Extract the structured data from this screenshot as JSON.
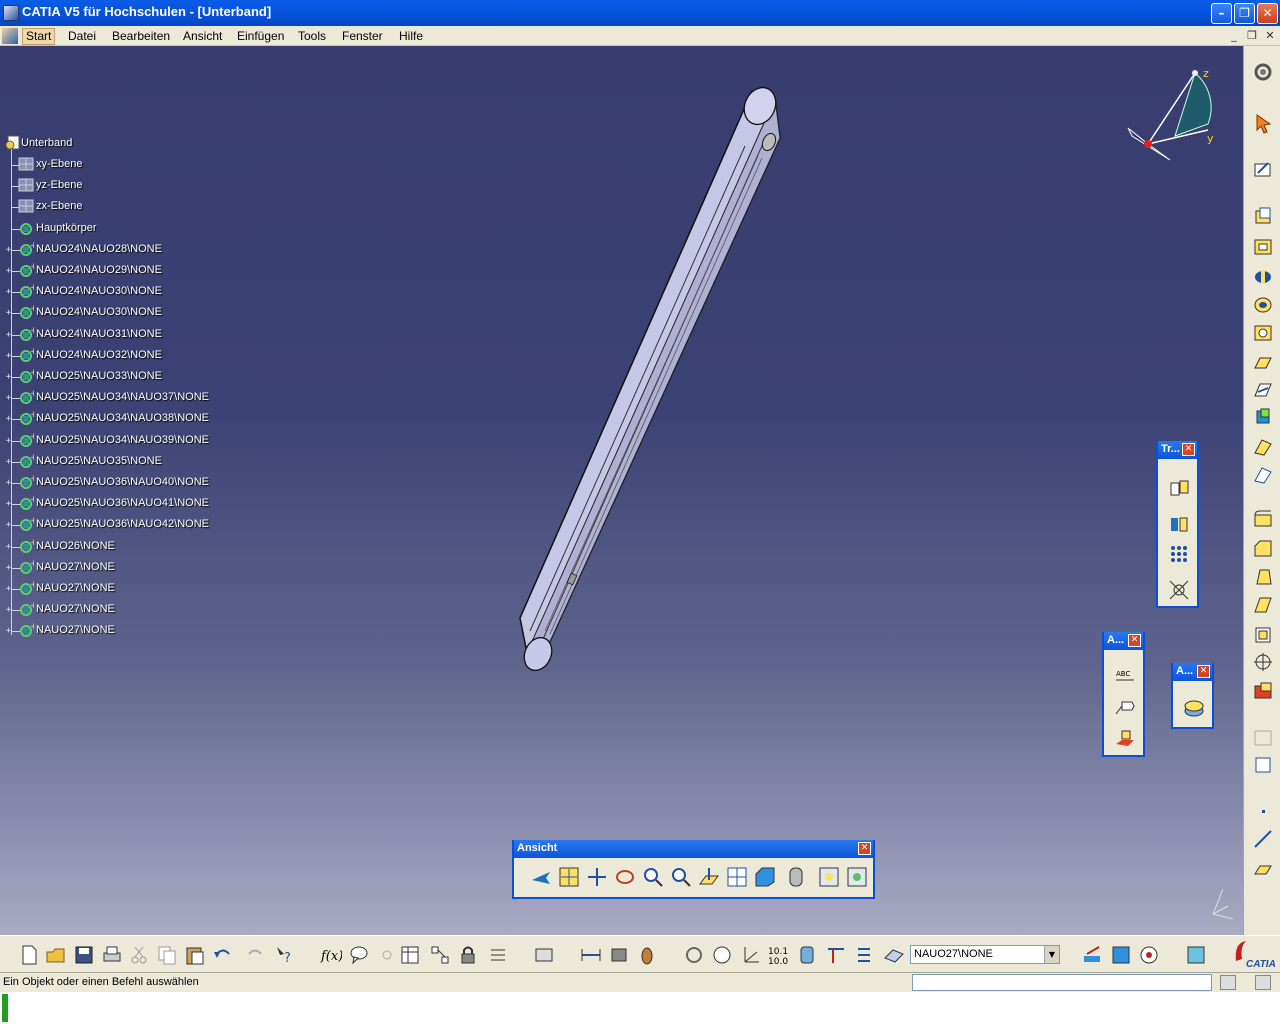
{
  "window": {
    "title": "CATIA V5 für Hochschulen - [Unterband]",
    "controls": [
      "minimize",
      "restore",
      "close"
    ]
  },
  "menu": {
    "items": [
      "Start",
      "Datei",
      "Bearbeiten",
      "Ansicht",
      "Einfügen",
      "Tools",
      "Fenster",
      "Hilfe"
    ],
    "active": "Start"
  },
  "tree": {
    "root": "Unterband",
    "items": [
      {
        "label": "xy-Ebene",
        "icon": "plane-icon",
        "expandable": false
      },
      {
        "label": "yz-Ebene",
        "icon": "plane-icon",
        "expandable": false
      },
      {
        "label": "zx-Ebene",
        "icon": "plane-icon",
        "expandable": false
      },
      {
        "label": "Hauptkörper",
        "icon": "body-icon",
        "expandable": false
      },
      {
        "label": "NAUO24\\NAUO28\\NONE",
        "icon": "body-icon",
        "expandable": true
      },
      {
        "label": "NAUO24\\NAUO29\\NONE",
        "icon": "body-icon",
        "expandable": true
      },
      {
        "label": "NAUO24\\NAUO30\\NONE",
        "icon": "body-icon",
        "expandable": true
      },
      {
        "label": "NAUO24\\NAUO30\\NONE",
        "icon": "body-icon",
        "expandable": true
      },
      {
        "label": "NAUO24\\NAUO31\\NONE",
        "icon": "body-icon",
        "expandable": true
      },
      {
        "label": "NAUO24\\NAUO32\\NONE",
        "icon": "body-icon",
        "expandable": true
      },
      {
        "label": "NAUO25\\NAUO33\\NONE",
        "icon": "body-icon",
        "expandable": true
      },
      {
        "label": "NAUO25\\NAUO34\\NAUO37\\NONE",
        "icon": "body-icon",
        "expandable": true
      },
      {
        "label": "NAUO25\\NAUO34\\NAUO38\\NONE",
        "icon": "body-icon",
        "expandable": true
      },
      {
        "label": "NAUO25\\NAUO34\\NAUO39\\NONE",
        "icon": "body-icon",
        "expandable": true
      },
      {
        "label": "NAUO25\\NAUO35\\NONE",
        "icon": "body-icon",
        "expandable": true
      },
      {
        "label": "NAUO25\\NAUO36\\NAUO40\\NONE",
        "icon": "body-icon",
        "expandable": true
      },
      {
        "label": "NAUO25\\NAUO36\\NAUO41\\NONE",
        "icon": "body-icon",
        "expandable": true
      },
      {
        "label": "NAUO25\\NAUO36\\NAUO42\\NONE",
        "icon": "body-icon",
        "expandable": true
      },
      {
        "label": "NAUO26\\NONE",
        "icon": "body-icon",
        "expandable": true
      },
      {
        "label": "NAUO27\\NONE",
        "icon": "body-icon",
        "expandable": true
      },
      {
        "label": "NAUO27\\NONE",
        "icon": "body-icon",
        "expandable": true
      },
      {
        "label": "NAUO27\\NONE",
        "icon": "body-icon",
        "expandable": true
      },
      {
        "label": "NAUO27\\NONE",
        "icon": "body-icon",
        "expandable": true
      }
    ]
  },
  "compass": {
    "axes": [
      "z",
      "y"
    ]
  },
  "palettes": {
    "ansicht": {
      "title": "Ansicht"
    },
    "tr": {
      "title": "Tr..."
    },
    "a1": {
      "title": "A..."
    },
    "a2": {
      "title": "A..."
    }
  },
  "annotation_icons": {
    "abc": "ABC"
  },
  "combo": {
    "value": "NAUO27\\NONE"
  },
  "status": {
    "message": "Ein Objekt oder einen Befehl auswählen"
  },
  "colors": {
    "titlebar": "#0650d8",
    "viewport_top": "#383c6e",
    "viewport_bottom": "#a9abc4",
    "part": "#c4c4e4",
    "chrome": "#ece9d8"
  }
}
